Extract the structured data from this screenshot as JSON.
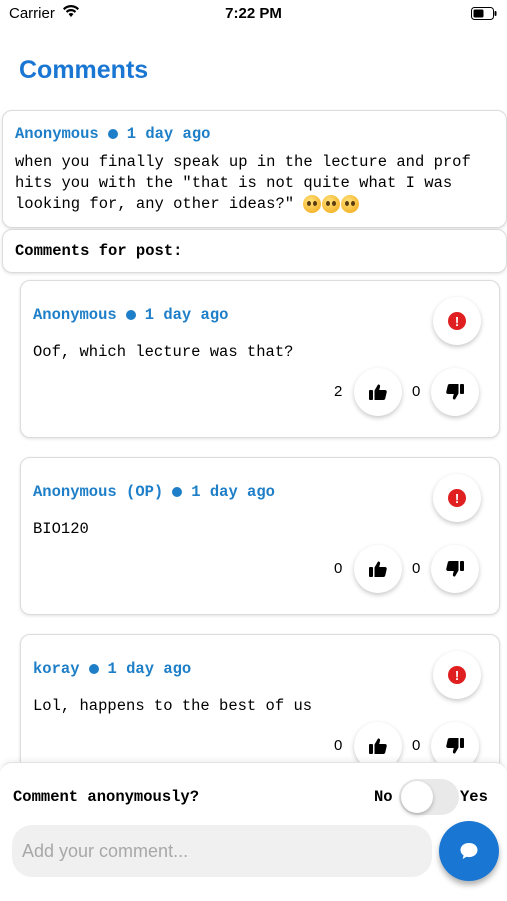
{
  "status_bar": {
    "carrier": "Carrier",
    "time": "7:22 PM"
  },
  "header": {
    "title": "Comments"
  },
  "post": {
    "author": "Anonymous",
    "time": "1 day ago",
    "body": "when you finally speak up in the lecture and prof hits you with the \"that is not quite what I was looking for, any other ideas?\""
  },
  "comments_section": {
    "label": "Comments for post:"
  },
  "comments": [
    {
      "author": "Anonymous",
      "time": "1 day ago",
      "text": "Oof, which lecture was that?",
      "upvotes": "2",
      "downvotes": "0"
    },
    {
      "author": "Anonymous (OP)",
      "time": "1 day ago",
      "text": "BIO120",
      "upvotes": "0",
      "downvotes": "0"
    },
    {
      "author": "koray",
      "time": "1 day ago",
      "text": "Lol, happens to the best of us",
      "upvotes": "0",
      "downvotes": "0"
    }
  ],
  "composer": {
    "anon_label": "Comment anonymously?",
    "toggle_off_label": "No",
    "toggle_on_label": "Yes",
    "toggle_state": "off",
    "placeholder": "Add your comment..."
  },
  "colors": {
    "accent": "#1976d2",
    "report": "#e02020"
  }
}
